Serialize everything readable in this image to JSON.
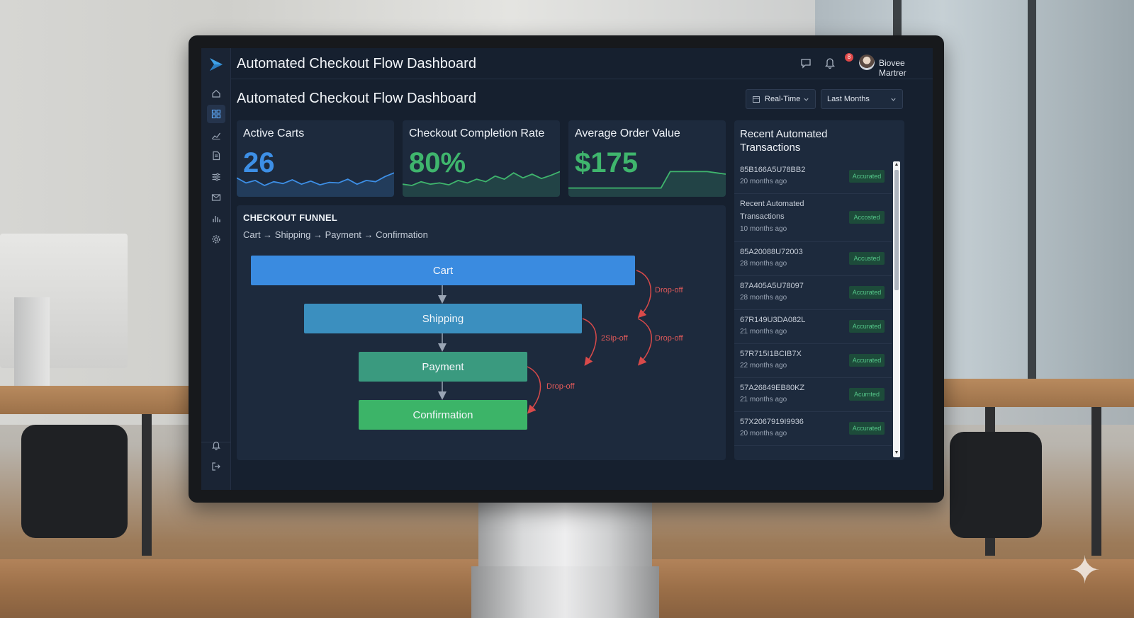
{
  "app": {
    "title": "Automated Checkout Flow Dashboard",
    "page_title": "Automated Checkout Flow Dashboard"
  },
  "header": {
    "notification_count": "8",
    "user_name": "Biovee Martrer"
  },
  "sidebar": {
    "items": [
      {
        "icon": "home-icon"
      },
      {
        "icon": "dashboard-grid-icon",
        "active": true
      },
      {
        "icon": "trend-chart-icon"
      },
      {
        "icon": "document-icon"
      },
      {
        "icon": "sliders-icon"
      },
      {
        "icon": "mail-icon"
      },
      {
        "icon": "bar-chart-icon"
      },
      {
        "icon": "gear-icon"
      }
    ],
    "bottom_items": [
      {
        "icon": "bell-icon"
      },
      {
        "icon": "logout-icon"
      }
    ]
  },
  "filters": {
    "mode": "Real-Time",
    "range": "Last Months"
  },
  "cards": [
    {
      "label": "Active Carts",
      "value": "26",
      "color": "#3d8fe6",
      "spark": [
        30,
        22,
        26,
        18,
        24,
        21,
        27,
        20,
        25,
        19,
        23,
        22,
        28,
        20,
        26,
        24,
        32,
        38
      ]
    },
    {
      "label": "Checkout Completion Rate",
      "value": "80%",
      "color": "#3fb56d",
      "spark": [
        20,
        18,
        24,
        20,
        22,
        19,
        26,
        22,
        28,
        24,
        33,
        28,
        38,
        30,
        36,
        29,
        34,
        40
      ]
    },
    {
      "label": "Average Order Value",
      "value": "$175",
      "color": "#3fb56d",
      "spark": [
        14,
        14,
        14,
        14,
        14,
        14,
        14,
        14,
        14,
        14,
        14,
        40,
        40,
        40,
        40,
        40,
        38,
        36
      ]
    }
  ],
  "funnel": {
    "title": "CHECKOUT FUNNEL",
    "subtitle": "Cart → Shipping → Payment → Confirmation",
    "stages": [
      {
        "label": "Cart",
        "color": "#3a8be0"
      },
      {
        "label": "Shipping",
        "color": "#3b8fbf"
      },
      {
        "label": "Payment",
        "color": "#3a9a7f"
      },
      {
        "label": "Confirmation",
        "color": "#3cb468"
      }
    ],
    "drop_labels": [
      "Drop-off",
      "2Sip-off",
      "Drop-off",
      "Drop-off"
    ],
    "drop_color": "#d94a4a"
  },
  "transactions": {
    "title": "Recent Automated Transactions",
    "items": [
      {
        "id": "85B166A5U78BB2",
        "time": "20 months ago",
        "status": "Accurated"
      },
      {
        "id": "Recent Automated",
        "id2": "Transactions",
        "time": "10 months ago",
        "status": "Accosted"
      },
      {
        "id": "85A20088U72003",
        "time": "28 months ago",
        "status": "Accusted"
      },
      {
        "id": "87A405A5U78097",
        "time": "28 months ago",
        "status": "Accurated"
      },
      {
        "id": "67R149U3DA082L",
        "time": "21 months ago",
        "status": "Accurated"
      },
      {
        "id": "57R715I1BCIB7X",
        "time": "22 months ago",
        "status": "Accurated"
      },
      {
        "id": "57A26849EB80KZ",
        "time": "21 months ago",
        "status": "Acurnted"
      },
      {
        "id": "57X2067919I9936",
        "time": "20 months ago",
        "status": "Accurated"
      }
    ]
  }
}
